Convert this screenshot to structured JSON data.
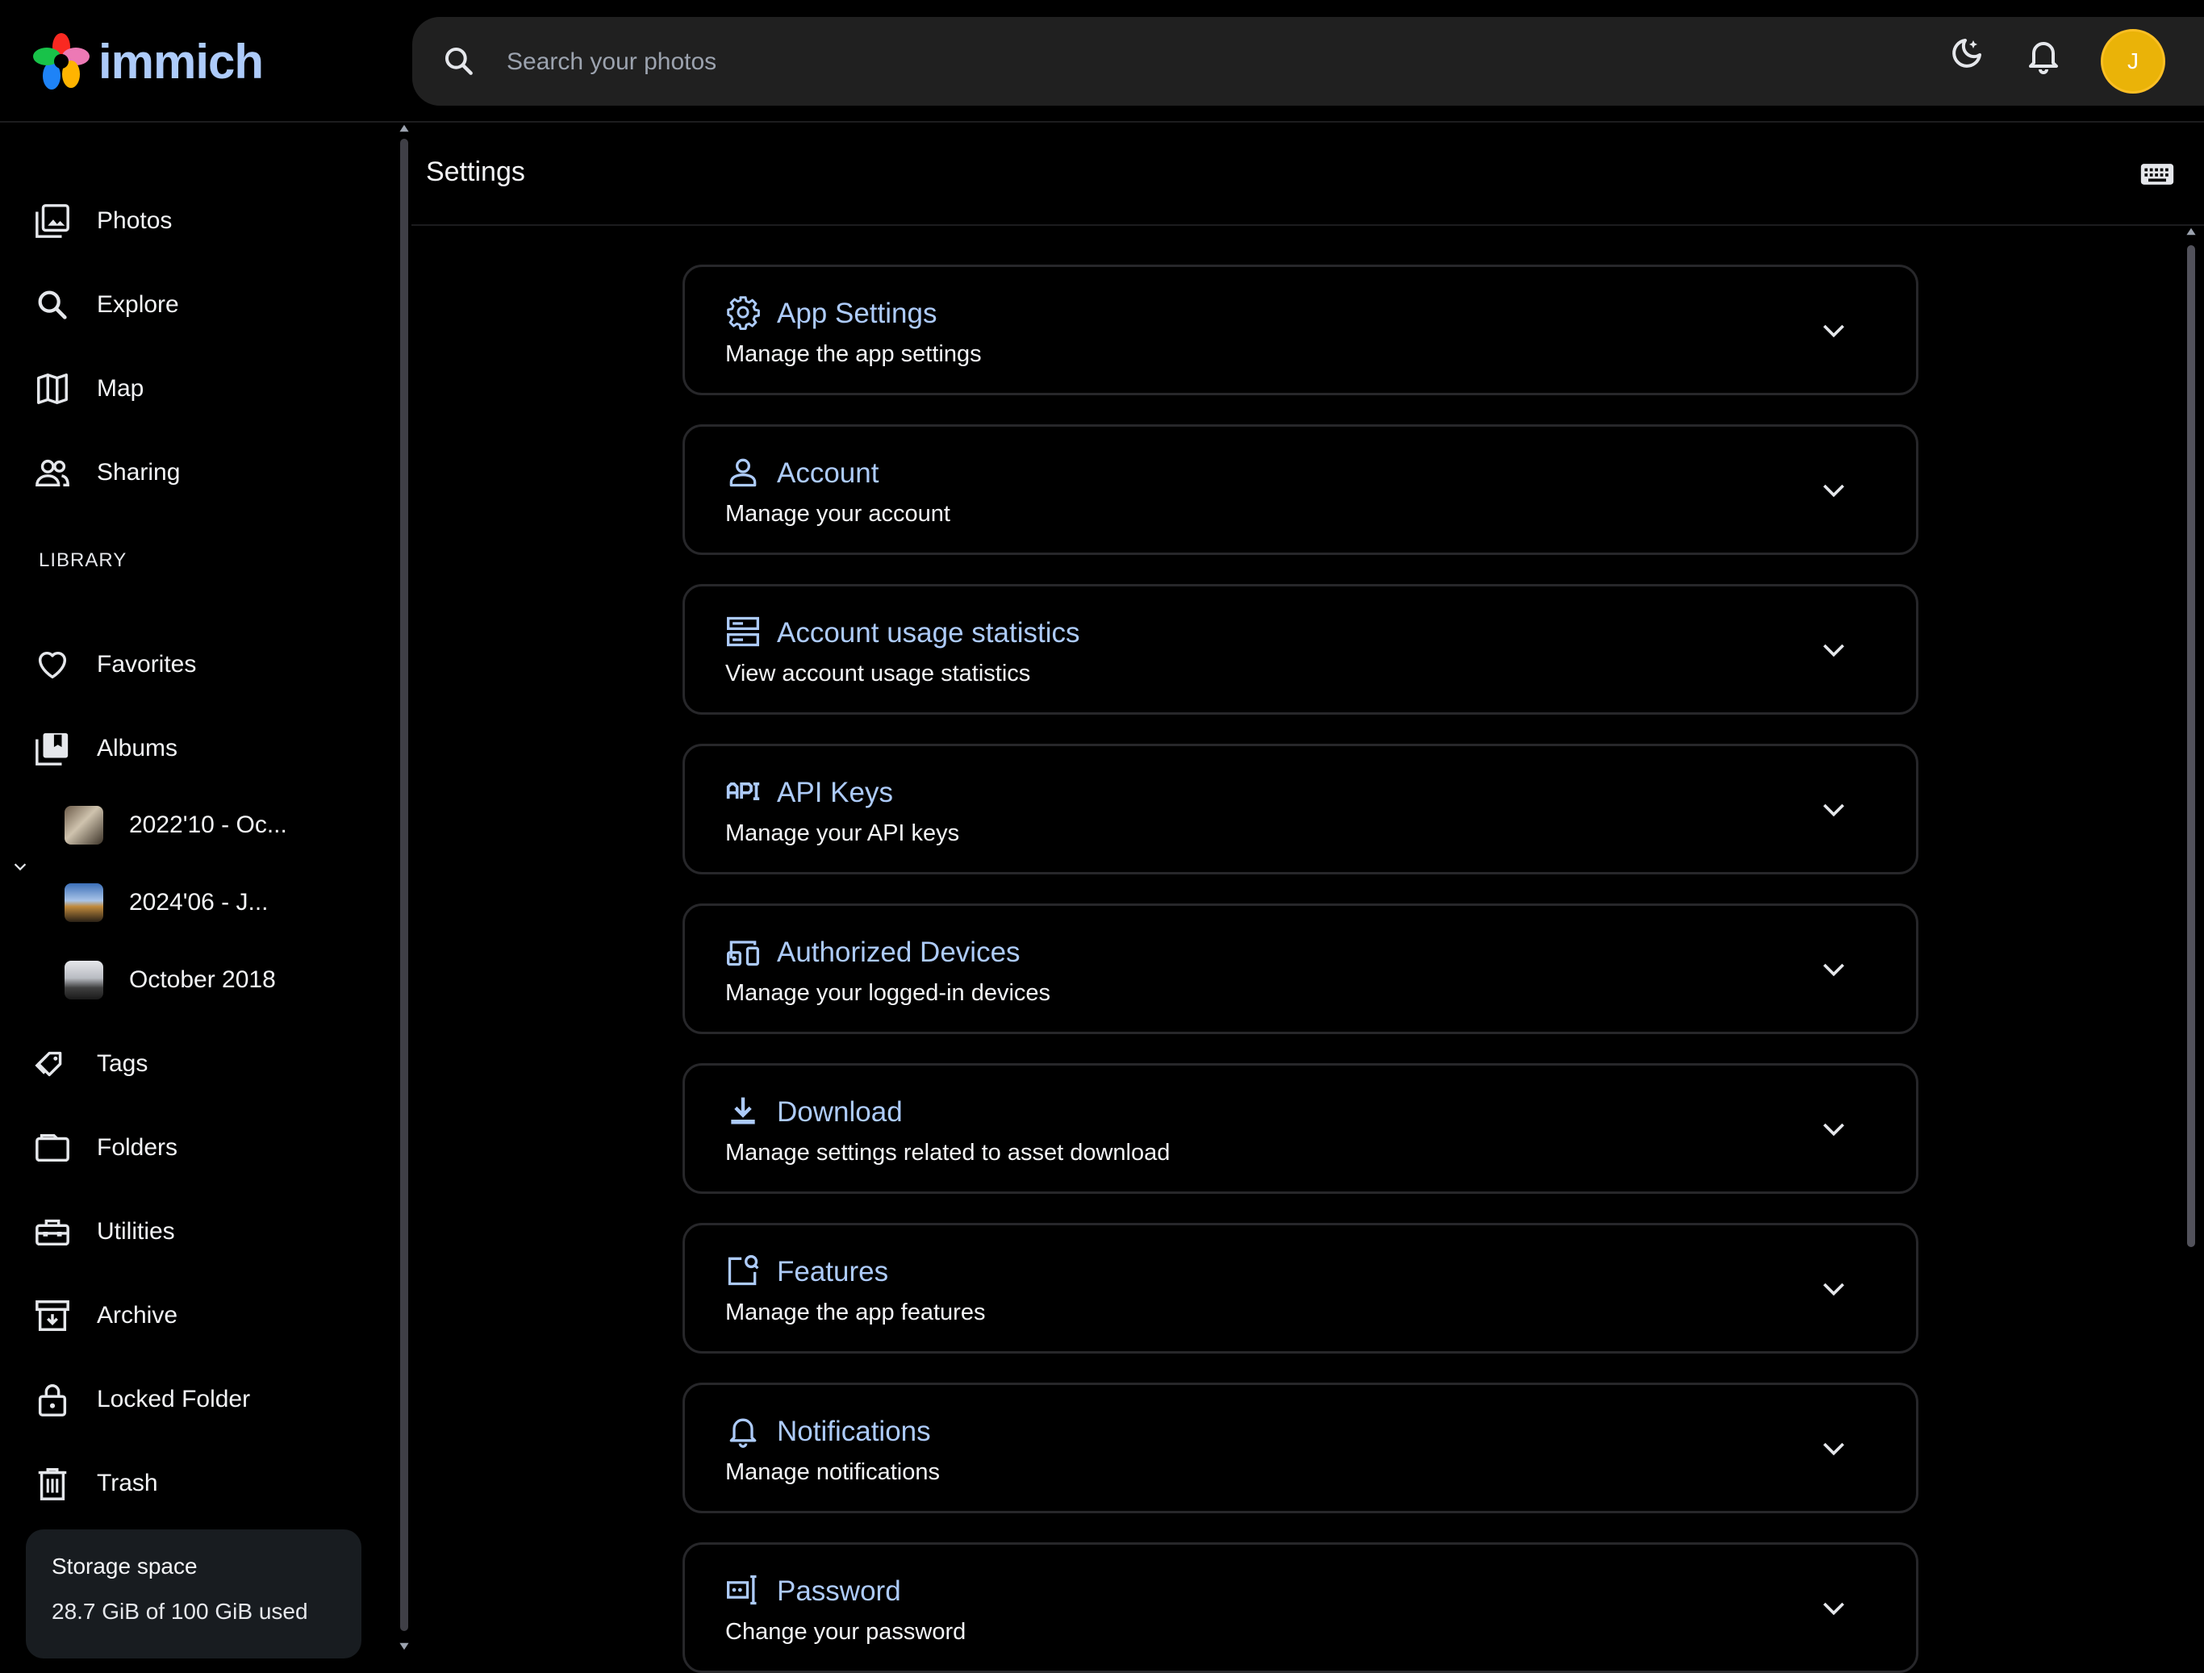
{
  "app": {
    "name": "immich"
  },
  "search": {
    "placeholder": "Search your photos"
  },
  "topbar": {
    "avatar_initial": "J"
  },
  "sidebar": {
    "nav": [
      {
        "label": "Photos",
        "icon": "photos-icon"
      },
      {
        "label": "Explore",
        "icon": "search-icon"
      },
      {
        "label": "Map",
        "icon": "map-icon"
      },
      {
        "label": "Sharing",
        "icon": "people-icon"
      }
    ],
    "library_title": "LIBRARY",
    "library": [
      {
        "label": "Favorites",
        "icon": "heart-icon"
      },
      {
        "label": "Albums",
        "icon": "album-icon"
      }
    ],
    "albums": [
      {
        "label": "2022'10 - Oc..."
      },
      {
        "label": "2024'06 - J..."
      },
      {
        "label": "October 2018"
      }
    ],
    "more": [
      {
        "label": "Tags",
        "icon": "tag-icon"
      },
      {
        "label": "Folders",
        "icon": "folder-icon"
      },
      {
        "label": "Utilities",
        "icon": "toolbox-icon"
      },
      {
        "label": "Archive",
        "icon": "archive-icon"
      },
      {
        "label": "Locked Folder",
        "icon": "lock-icon"
      },
      {
        "label": "Trash",
        "icon": "trash-icon"
      }
    ],
    "storage": {
      "title": "Storage space",
      "usage": "28.7 GiB of 100 GiB used"
    }
  },
  "page": {
    "title": "Settings"
  },
  "settings": [
    {
      "title": "App Settings",
      "subtitle": "Manage the app settings",
      "icon": "gear-icon"
    },
    {
      "title": "Account",
      "subtitle": "Manage your account",
      "icon": "person-icon"
    },
    {
      "title": "Account usage statistics",
      "subtitle": "View account usage statistics",
      "icon": "server-icon"
    },
    {
      "title": "API Keys",
      "subtitle": "Manage your API keys",
      "icon": "api-icon"
    },
    {
      "title": "Authorized Devices",
      "subtitle": "Manage your logged-in devices",
      "icon": "devices-icon"
    },
    {
      "title": "Download",
      "subtitle": "Manage settings related to asset download",
      "icon": "download-icon"
    },
    {
      "title": "Features",
      "subtitle": "Manage the app features",
      "icon": "features-icon"
    },
    {
      "title": "Notifications",
      "subtitle": "Manage notifications",
      "icon": "bell-icon"
    },
    {
      "title": "Password",
      "subtitle": "Change your password",
      "icon": "password-icon"
    }
  ],
  "colors": {
    "accent": "#adcbfa",
    "avatar": "#eab308",
    "background": "#000000"
  }
}
